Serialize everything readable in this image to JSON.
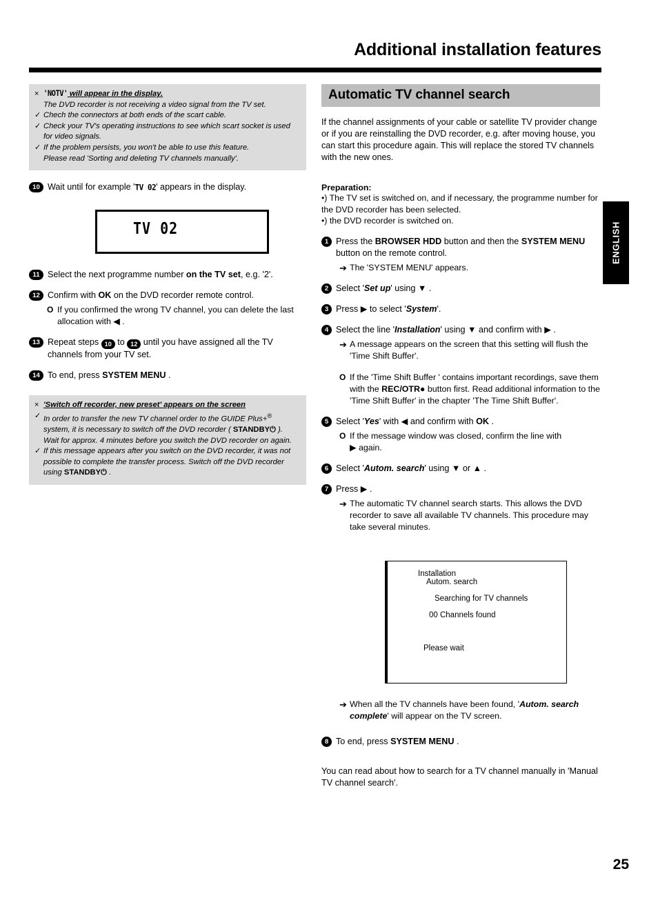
{
  "header": {
    "title": "Additional installation features"
  },
  "language_tab": {
    "label": "ENGLISH"
  },
  "folio": {
    "page_number": "25"
  },
  "left_column": {
    "note_box_top": {
      "head_mark": "×",
      "head_lcd": "'NOTV'",
      "head_text": " will appear in the display.",
      "head_sub": "The DVD recorder is not receiving a video signal from the TV set.",
      "items": [
        {
          "mark": "✓",
          "text": "Chech the connectors at both ends of the scart cable."
        },
        {
          "mark": "✓",
          "text": "Check your TV's operating instructions to see which scart socket is used for video signals."
        },
        {
          "mark": "✓",
          "text": "If the problem persists, you won't be able to use this feature.",
          "sub": "Please read 'Sorting and deleting TV channels manually'."
        }
      ]
    },
    "steps": [
      {
        "num": "10",
        "pre": "Wait until for example '",
        "lcd": "TV  02",
        "post": "' appears in the display."
      },
      {
        "num": "11",
        "pre": "Select the next programme number ",
        "bold": "on the TV set",
        "post": ", e.g. '2'."
      },
      {
        "num": "12",
        "pre": "Confirm with  ",
        "bold": "OK",
        "post": " on the DVD recorder remote control."
      },
      {
        "num": "13",
        "pre": "Repeat steps ",
        "post": " until you have assigned all the TV channels from your TV set.",
        "mid": " to "
      },
      {
        "num": "14",
        "pre": "To end, press  ",
        "bold": "SYSTEM MENU",
        "post": " ."
      }
    ],
    "step12_sub": {
      "mark": "O",
      "pre": "If you confirmed the wrong TV channel, you can delete the last allocation with  ",
      "glyph": "◀",
      "post": " ."
    },
    "step13_refs": {
      "from": "10",
      "to": "12"
    },
    "lcd_display": {
      "value": "TV 02"
    },
    "note_box_bottom": {
      "head_mark": "×",
      "head_text": "'Switch off recorder, new preset' appears on the screen",
      "items": [
        {
          "mark": "✓",
          "part1": "In order to transfer the new TV channel order to the GUIDE Plus+",
          "sup": "®",
          "part2": " system, it is necessary to switch off the DVD recorder ( ",
          "bold": "STANDBY",
          "glyph": "⏻",
          "part3": " ). Wait for approx. 4 minutes before you switch the DVD recorder on again."
        },
        {
          "mark": "✓",
          "part1": "If this message appears after you switch on the DVD recorder, it was not possible to complete the transfer process. Switch off the DVD recorder using  ",
          "bold": "STANDBY",
          "glyph": "⏻",
          "part3": " ."
        }
      ]
    }
  },
  "right_column": {
    "section_title": "Automatic TV channel search",
    "intro": "If the channel assignments of your cable or satellite TV provider change or if you are reinstalling the DVD recorder, e.g. after moving house, you can start this procedure again. This will replace the stored TV channels with the new ones.",
    "preparation": {
      "title": "Preparation:",
      "lines": [
        "•) The TV set is switched on, and if necessary, the programme number for the DVD recorder has been selected.",
        "•) the DVD recorder is switched on."
      ]
    },
    "step1": {
      "num": "1",
      "pre": "Press the  ",
      "bold1": "BROWSER HDD",
      "mid": " button and then the  ",
      "bold2": "SYSTEM MENU",
      "post": " button on the remote control.",
      "sub_mark": "➔",
      "sub_text": "The 'SYSTEM MENU' appears."
    },
    "step2": {
      "num": "2",
      "pre": "Select '",
      "ital": "Set up",
      "mid": "' using  ",
      "glyph": "▼",
      "post": " ."
    },
    "step3": {
      "num": "3",
      "pre": "Press ",
      "glyph": "▶",
      "mid": " to select '",
      "ital": "System",
      "post": "'."
    },
    "step4": {
      "num": "4",
      "pre": "Select the line '",
      "ital": "Installation",
      "mid": "' using  ",
      "glyph1": "▼",
      "mid2": " and confirm with  ",
      "glyph2": "▶",
      "post": " .",
      "sub_mark": "➔",
      "sub_text": "A message appears on the screen that this setting will flush the 'Time Shift Buffer'.",
      "bullet_mark": "O",
      "bullet_pre": "If the 'Time Shift Buffer ' contains important recordings, save them with the  ",
      "bullet_bold": "REC/OTR",
      "bullet_glyph": "●",
      "bullet_post": " button first. Read additional information to the 'Time Shift Buffer' in the chapter 'The Time Shift Buffer'."
    },
    "step5": {
      "num": "5",
      "pre": "Select '",
      "ital": "Yes",
      "mid": "' with  ",
      "glyph": "◀",
      "mid2": " and confirm with  ",
      "bold": "OK",
      "post": " .",
      "bullet_mark": "O",
      "bullet_pre": "If the message window was closed, confirm the line with ",
      "bullet_glyph": "▶",
      "bullet_post": " again."
    },
    "step6": {
      "num": "6",
      "pre": "Select '",
      "ital": "Autom. search",
      "mid": "' using ",
      "glyph1": "▼",
      "mid2": " or ",
      "glyph2": "▲",
      "post": " ."
    },
    "step7": {
      "num": "7",
      "pre": "Press ",
      "glyph": "▶",
      "post": " .",
      "sub_mark": "➔",
      "sub_text": "The automatic TV channel search starts. This allows the DVD recorder to save all available TV channels. This procedure may take several minutes."
    },
    "tv_screen": {
      "line1": "Installation",
      "line2": "Autom. search",
      "line3": "Searching for TV channels",
      "line4": "00 Channels found",
      "line5": "Please wait"
    },
    "after_screen": {
      "mark": "➔",
      "pre": "When all the TV channels have been found, '",
      "ital": "Autom. search complete",
      "post": "' will appear on the TV screen."
    },
    "step8": {
      "num": "8",
      "pre": "To end, press  ",
      "bold": "SYSTEM MENU",
      "post": " ."
    },
    "tail": "You can read about how to search for a TV channel manually in 'Manual TV channel search'."
  }
}
